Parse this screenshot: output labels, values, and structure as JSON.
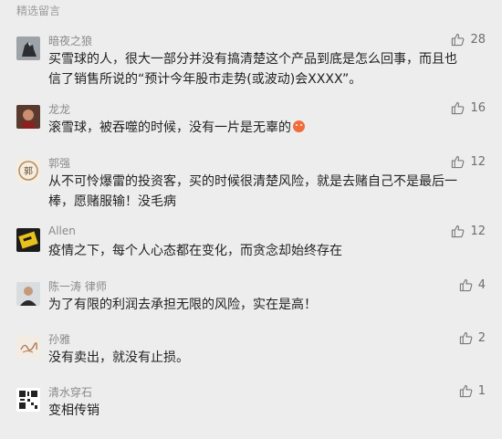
{
  "section": {
    "title": "精选留言"
  },
  "comments": [
    {
      "name": "暗夜之狼",
      "text": "买雪球的人，很大一部分并没有搞清楚这个产品到底是怎么回事，而且也信了销售所说的“预计今年股市走势(或波动)会XXXX”。",
      "likes": "28"
    },
    {
      "name": "龙龙",
      "text": "滚雪球，被吞噬的时候，没有一片是无辜的",
      "likes": "16"
    },
    {
      "name": "郭强",
      "text": "从不可怜爆雷的投资客，买的时候很清楚风险，就是去赌自己不是最后一棒，愿赌服输！没毛病",
      "likes": "12"
    },
    {
      "name": "Allen",
      "text": "疫情之下，每个人心态都在变化，而贪念却始终存在",
      "likes": "12"
    },
    {
      "name": "陈一涛  律师",
      "text": "为了有限的利润去承担无限的风险，实在是高！",
      "likes": "4"
    },
    {
      "name": "孙雅",
      "text": "没有卖出，就没有止损。",
      "likes": "2"
    },
    {
      "name": "清水穿石",
      "text": "变相传销",
      "likes": "1"
    }
  ],
  "icons": {
    "like": "thumbs-up-icon",
    "emoji": "angry-face-emoji-icon"
  },
  "colors": {
    "background": "#ededed",
    "name": "#8a8a8a",
    "text": "#222222",
    "like": "#6e6e6e"
  }
}
